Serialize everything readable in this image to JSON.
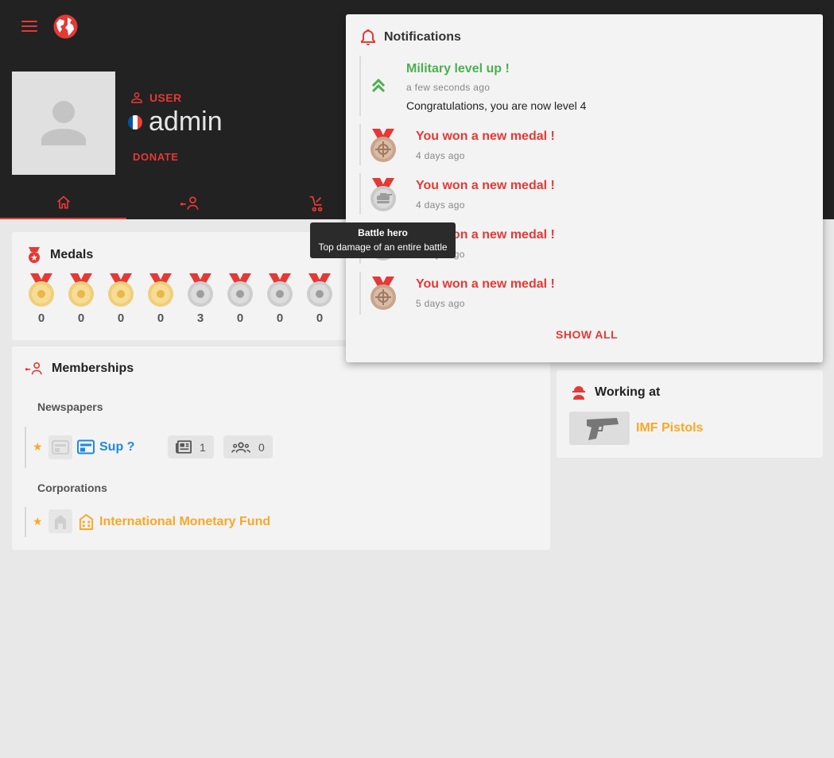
{
  "profile": {
    "role": "USER",
    "username": "admin",
    "donate_label": "DONATE",
    "flag_colors": [
      "#0055a4",
      "#ffffff",
      "#ef4135"
    ]
  },
  "tabs": [
    {
      "icon": "home-icon",
      "active": true
    },
    {
      "icon": "memberships-icon",
      "active": false
    },
    {
      "icon": "work-icon",
      "active": false
    }
  ],
  "medals": {
    "title": "Medals",
    "items": [
      {
        "icon": "fire-medal-icon",
        "count": "0",
        "tone": "gold"
      },
      {
        "icon": "person-medal-icon",
        "count": "0",
        "tone": "gold"
      },
      {
        "icon": "flag-medal-icon",
        "count": "0",
        "tone": "gold"
      },
      {
        "icon": "crown-medal-icon",
        "count": "0",
        "tone": "gold"
      },
      {
        "icon": "tank-medal-icon",
        "count": "3",
        "tone": "silver"
      },
      {
        "icon": "bank-medal-icon",
        "count": "0",
        "tone": "silver"
      },
      {
        "icon": "tower-medal-icon",
        "count": "0",
        "tone": "silver"
      },
      {
        "icon": "vial-medal-icon",
        "count": "0",
        "tone": "silver"
      }
    ]
  },
  "memberships": {
    "title": "Memberships",
    "newspapers_label": "Newspapers",
    "newspaper": {
      "name": "Sup ?",
      "articles": "1",
      "subscribers": "0"
    },
    "corporations_label": "Corporations",
    "corporation": {
      "name": "International Monetary Fund"
    }
  },
  "working": {
    "title": "Working at",
    "company": "IMF Pistols"
  },
  "notifications": {
    "title": "Notifications",
    "items": [
      {
        "heading": "Military level up !",
        "time": "a few seconds ago",
        "body": "Congratulations, you are now level 4"
      },
      {
        "heading": "You won a new medal !",
        "time": "4 days ago"
      },
      {
        "heading": "You won a new medal !",
        "time": "4 days ago"
      },
      {
        "heading": "You won a new medal !",
        "time": "4 days ago"
      },
      {
        "heading": "You won a new medal !",
        "time": "5 days ago"
      }
    ],
    "show_all": "SHOW ALL"
  },
  "tooltip": {
    "title": "Battle hero",
    "text": "Top damage of an entire battle"
  },
  "colors": {
    "accent": "#e53935",
    "success": "#4caf50",
    "link_blue": "#1e88e5",
    "link_orange": "#f9a825"
  }
}
